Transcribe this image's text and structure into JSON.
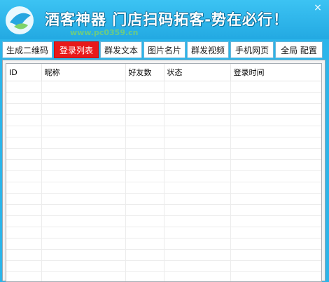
{
  "window": {
    "title": "酒客神器 门店扫码拓客-势在必行！",
    "watermark": "www.pc0359.cn",
    "close_label": "×"
  },
  "tabs": [
    {
      "label": "生成二维码",
      "active": false
    },
    {
      "label": "登录列表",
      "active": true
    },
    {
      "label": "群发文本",
      "active": false
    },
    {
      "label": "图片名片",
      "active": false
    },
    {
      "label": "群发视频",
      "active": false
    },
    {
      "label": "手机网页",
      "active": false
    },
    {
      "label": "全局 配置",
      "active": false
    }
  ],
  "table": {
    "columns": [
      "ID",
      "昵称",
      "好友数",
      "状态",
      "登录时间"
    ],
    "rows": []
  },
  "colors": {
    "titlebar": "#2bb5ea",
    "active_tab": "#e8191a",
    "title_text": "#ffffff"
  }
}
